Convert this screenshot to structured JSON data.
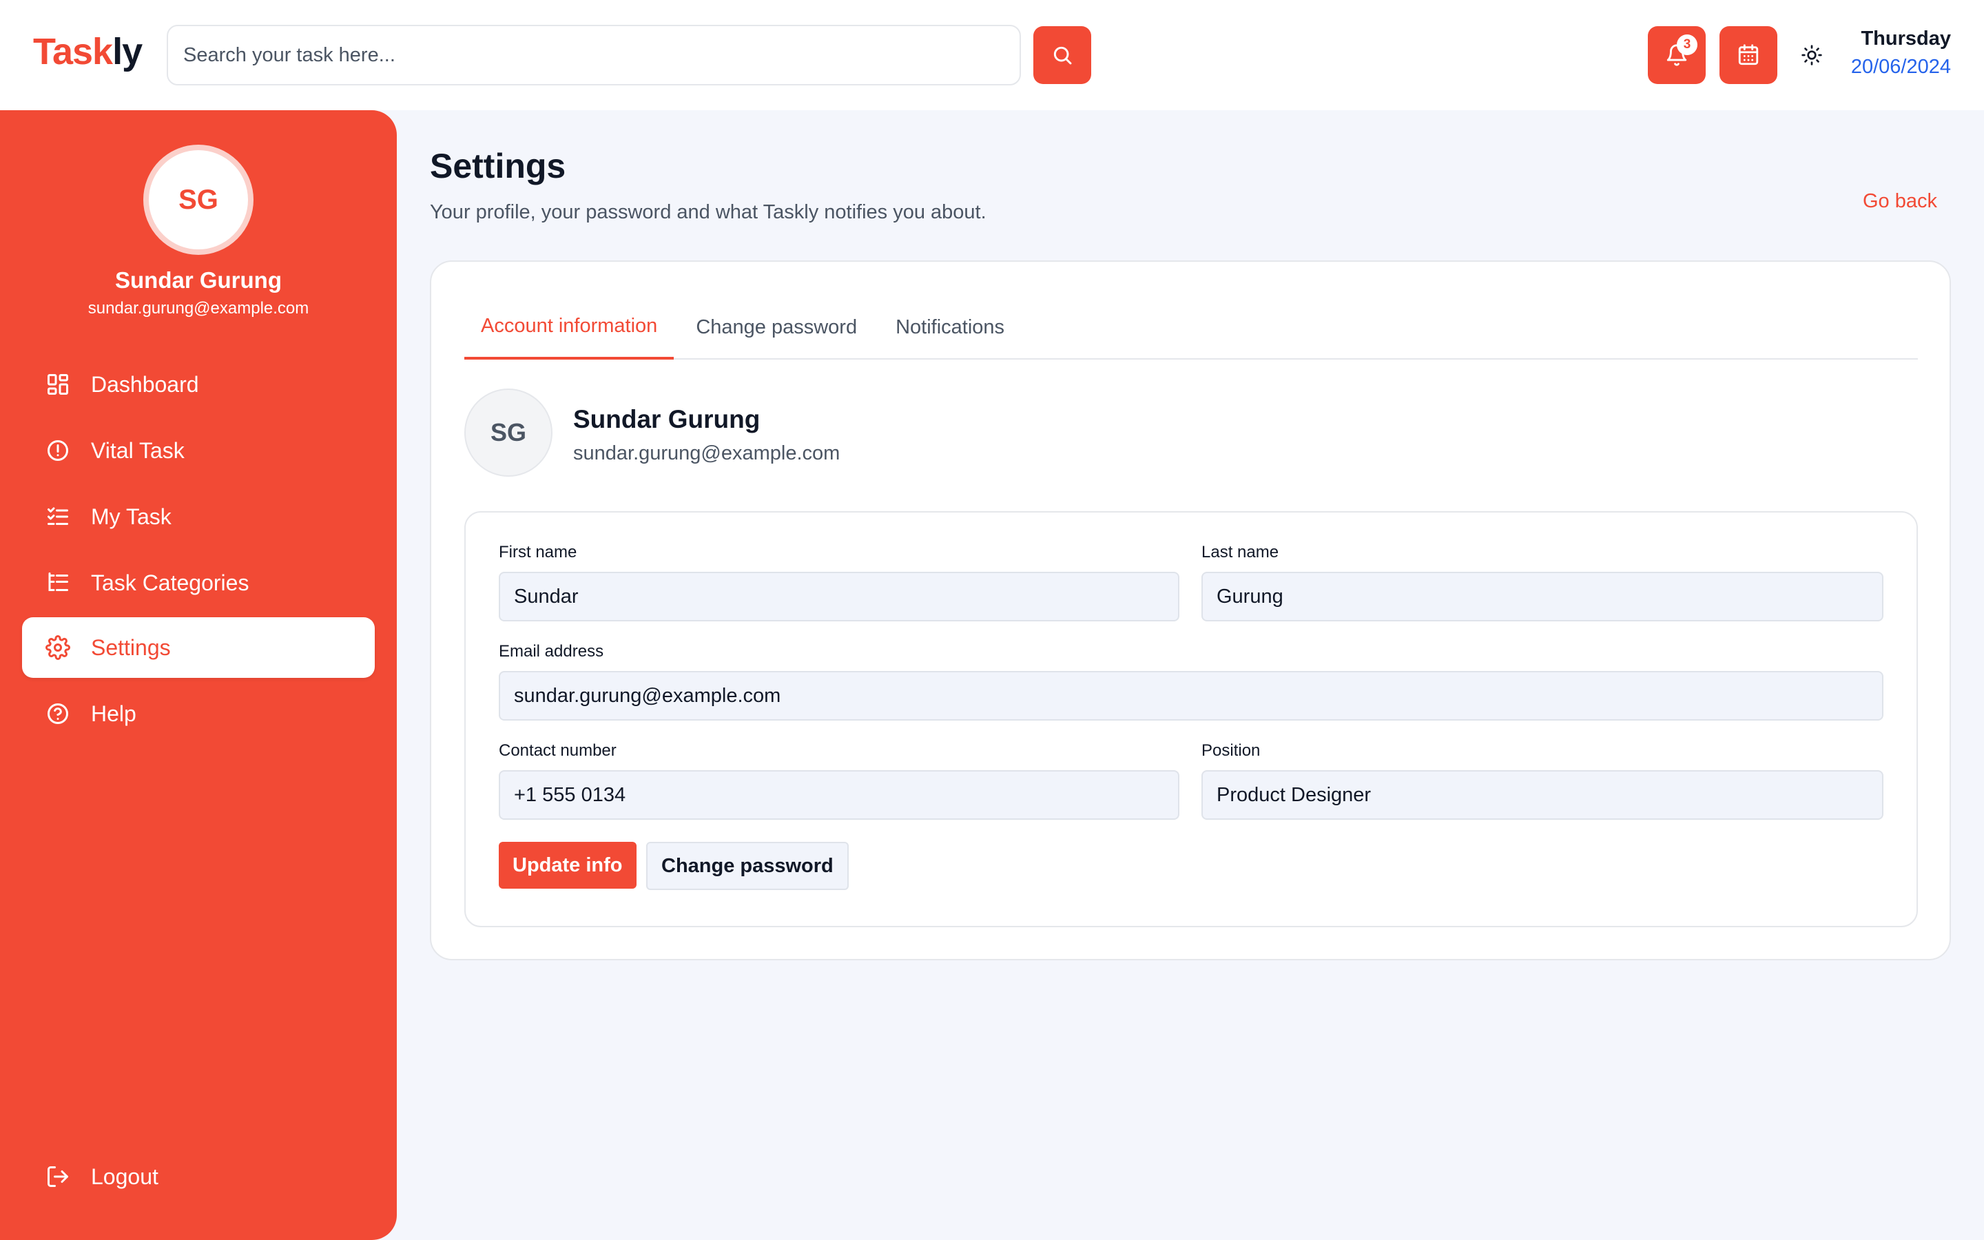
{
  "brand": {
    "part1": "Task",
    "part2": "ly",
    "accent_color": "#f24a35"
  },
  "search": {
    "placeholder": "Search your task here...",
    "value": ""
  },
  "header": {
    "notifications_count": "3",
    "date_day": "Thursday",
    "date_value": "20/06/2024",
    "icons": [
      "search-icon",
      "bell-icon",
      "calendar-icon",
      "sun-icon"
    ]
  },
  "sidebar": {
    "avatar_initials": "SG",
    "user_name": "Sundar Gurung",
    "user_email": "sundar.gurung@example.com",
    "items": [
      {
        "label": "Dashboard",
        "icon": "dashboard-icon"
      },
      {
        "label": "Vital Task",
        "icon": "alert-circle-icon"
      },
      {
        "label": "My Task",
        "icon": "checklist-icon"
      },
      {
        "label": "Task Categories",
        "icon": "list-tree-icon"
      },
      {
        "label": "Settings",
        "icon": "gear-icon",
        "active": true
      },
      {
        "label": "Help",
        "icon": "help-circle-icon"
      }
    ],
    "logout_label": "Logout"
  },
  "page": {
    "title": "Settings",
    "subtitle": "Your profile, your password and what Taskly notifies you about.",
    "go_back": "Go back"
  },
  "tabs": [
    {
      "label": "Account information",
      "active": true
    },
    {
      "label": "Change password"
    },
    {
      "label": "Notifications"
    }
  ],
  "profile": {
    "initials": "SG",
    "name": "Sundar Gurung",
    "email": "sundar.gurung@example.com"
  },
  "form": {
    "first_name_label": "First name",
    "first_name": "Sundar",
    "last_name_label": "Last name",
    "last_name": "Gurung",
    "email_label": "Email address",
    "email": "sundar.gurung@example.com",
    "contact_label": "Contact number",
    "contact": "+1 555 0134",
    "position_label": "Position",
    "position": "Product Designer",
    "update_label": "Update info",
    "change_password_label": "Change password"
  }
}
